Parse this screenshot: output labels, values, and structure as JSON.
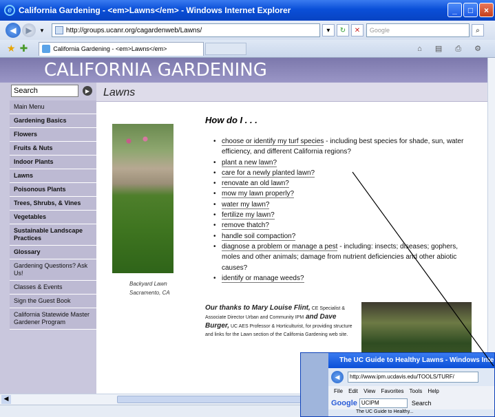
{
  "window": {
    "title": "California Gardening - <em>Lawns</em> - Windows Internet Explorer",
    "minimize": "_",
    "maximize": "□",
    "close": "×"
  },
  "address_bar": {
    "url": "http://groups.ucanr.org/cagardenweb/Lawns/",
    "search_placeholder": "Google"
  },
  "tab": {
    "title": "California Gardening - <em>Lawns</em>"
  },
  "page": {
    "banner": "CALIFORNIA GARDENING",
    "search_placeholder": "Search",
    "section_title": "Lawns",
    "nav": [
      {
        "label": "Main Menu",
        "bold": false
      },
      {
        "label": "Gardening Basics",
        "bold": true
      },
      {
        "label": "Flowers",
        "bold": true
      },
      {
        "label": "Fruits & Nuts",
        "bold": true
      },
      {
        "label": "Indoor Plants",
        "bold": true
      },
      {
        "label": "Lawns",
        "bold": true
      },
      {
        "label": "Poisonous Plants",
        "bold": true
      },
      {
        "label": "Trees, Shrubs, & Vines",
        "bold": true
      },
      {
        "label": "Vegetables",
        "bold": true
      },
      {
        "label": "Sustainable Landscape Practices",
        "bold": true
      },
      {
        "label": "Glossary",
        "bold": true
      },
      {
        "label": "Gardening Questions? Ask Us!",
        "bold": false
      },
      {
        "label": "Classes & Events",
        "bold": false
      },
      {
        "label": "Sign the Guest Book",
        "bold": false
      },
      {
        "label": "California Statewide Master Gardener Program",
        "bold": false
      }
    ],
    "photo_caption_1": "Backyard Lawn",
    "photo_caption_2": "Sacramento, CA",
    "how_do_i": "How do I . . .",
    "questions": [
      {
        "link": "choose or identify my turf species",
        "rest": " - including best species for shade, sun, water efficiency, and different California regions?"
      },
      {
        "link": "plant a new lawn?",
        "rest": ""
      },
      {
        "link": "care for a newly planted lawn?",
        "rest": ""
      },
      {
        "link": "renovate an old lawn?",
        "rest": ""
      },
      {
        "link": "mow my lawn properly?",
        "rest": ""
      },
      {
        "link": "water my lawn?",
        "rest": ""
      },
      {
        "link": "fertilize my lawn?",
        "rest": ""
      },
      {
        "link": "remove thatch?",
        "rest": ""
      },
      {
        "link": "handle soil compaction?",
        "rest": ""
      },
      {
        "link": "diagnose a problem or manage a pest",
        "rest": " - including: insects; diseases; gophers, moles and other animals; damage from nutrient deficiencies and other abiotic causes?"
      },
      {
        "link": "identify or manage weeds?",
        "rest": ""
      }
    ],
    "thanks_big_1": "Our thanks to Mary Louise Flint,",
    "thanks_small_1": " CE Specialist & Associate Director Urban and Community IPM",
    "thanks_big_2": " and Dave Burger,",
    "thanks_small_2": " UC AES Professor & Horticulturist, for providing structure and links for the Lawn section of the California Gardening web site."
  },
  "second_window": {
    "title": "The UC Guide to Healthy Lawns - Windows Internet",
    "url": "http://www.ipm.ucdavis.edu/TOOLS/TURF/",
    "menu": "File Edit View Favorites Tools Help",
    "google_logo": "Google",
    "google_query": "UCIPM",
    "search_label": "Search",
    "tab_title": "The UC Guide to Healthy..."
  }
}
